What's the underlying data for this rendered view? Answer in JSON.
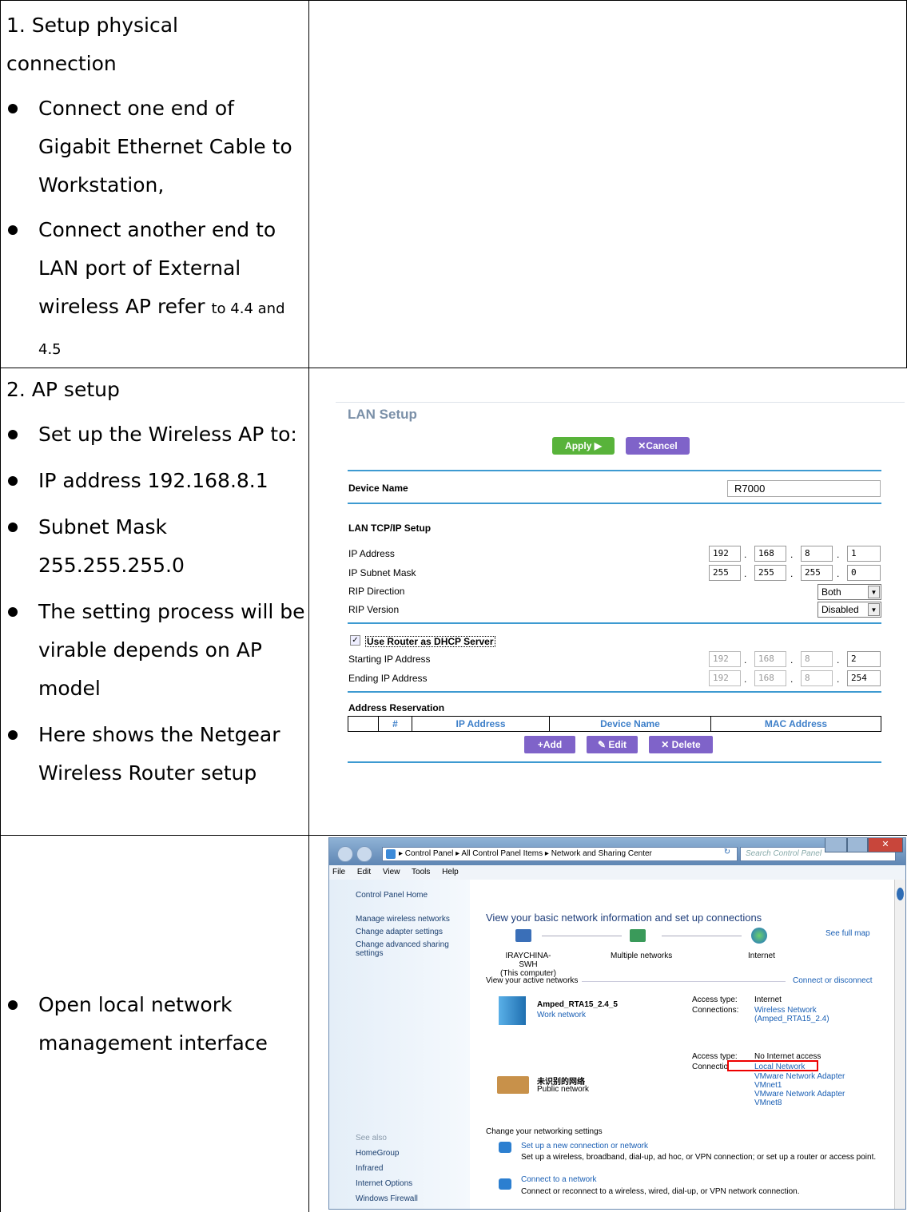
{
  "rows": [
    {
      "heading": "1. Setup physical connection",
      "bullets": [
        {
          "text": "Connect one end of Gigabit Ethernet Cable to Workstation,"
        },
        {
          "text": "Connect another end to LAN port of External wireless AP refer",
          "small": "to 4.4 and 4.5"
        }
      ]
    },
    {
      "heading": "2. AP setup",
      "bullets": [
        {
          "text": "Set up the Wireless AP to:"
        },
        {
          "text": "IP address 192.168.8.1"
        },
        {
          "text": "Subnet Mask 255.255.255.0"
        },
        {
          "text": "The setting process will be  virable depends on AP model"
        },
        {
          "text": "Here shows the Netgear Wireless Router setup"
        }
      ]
    },
    {
      "bullets": [
        {
          "text": "Open local network management interface"
        }
      ]
    }
  ],
  "lan_setup": {
    "title": "LAN Setup",
    "apply_label": "Apply ▶",
    "cancel_label": "✕Cancel",
    "device_name_label": "Device Name",
    "device_name_value": "R7000",
    "tcpip_title": "LAN TCP/IP Setup",
    "ip_address_label": "IP Address",
    "ip_address": [
      "192",
      "168",
      "8",
      "1"
    ],
    "subnet_label": "IP Subnet Mask",
    "subnet": [
      "255",
      "255",
      "255",
      "0"
    ],
    "rip_direction_label": "RIP Direction",
    "rip_direction_value": "Both",
    "rip_version_label": "RIP Version",
    "rip_version_value": "Disabled",
    "dhcp_label": "Use Router as DHCP Server",
    "dhcp_checked": true,
    "start_ip_label": "Starting IP Address",
    "start_ip": [
      "192",
      "168",
      "8",
      "2"
    ],
    "end_ip_label": "Ending IP Address",
    "end_ip": [
      "192",
      "168",
      "8",
      "254"
    ],
    "reservation_title": "Address Reservation",
    "reservation_columns": [
      "",
      "#",
      "IP Address",
      "Device Name",
      "MAC Address"
    ],
    "add_label": "+Add",
    "edit_label": "Edit",
    "delete_label": "✕ Delete",
    "colors": {
      "apply": "#58b33a",
      "purple": "#7f63c9",
      "rule": "#3d9ad1",
      "title": "#7b90a8"
    }
  },
  "windows": {
    "breadcrumb": "▸ Control Panel ▸ All Control Panel Items ▸ Network and Sharing Center",
    "search_placeholder": "Search Control Panel",
    "menu": [
      "File",
      "Edit",
      "View",
      "Tools",
      "Help"
    ],
    "left_links": [
      "Control Panel Home",
      "Manage wireless networks",
      "Change adapter settings",
      "Change advanced sharing settings"
    ],
    "see_also_title": "See also",
    "see_also": [
      "HomeGroup",
      "Infrared",
      "Internet Options",
      "Windows Firewall"
    ],
    "heading": "View your basic network information and set up connections",
    "see_full_map": "See full map",
    "computer_name": "IRAYCHINA-SWH",
    "computer_sub": "(This computer)",
    "multiple_networks": "Multiple networks",
    "internet": "Internet",
    "active_networks": "View your active networks",
    "connect_disconnect": "Connect or disconnect",
    "net1_name": "Amped_RTA15_2.4_5",
    "net1_type": "Work network",
    "access_type_label": "Access type:",
    "net1_access": "Internet",
    "connections_label": "Connections:",
    "net1_conn1": "Wireless Network",
    "net1_conn2": "(Amped_RTA15_2.4)",
    "net2_name": "未识别的网络",
    "net2_type": "Public network",
    "net2_access": "No Internet access",
    "net2_conn_label": "Connectio",
    "net2_conn1": "Local Network",
    "net2_conn2": "VMware Network Adapter",
    "net2_conn3": "VMnet1",
    "net2_conn4": "VMware Network Adapter",
    "net2_conn5": "VMnet8",
    "change_settings": "Change your networking settings",
    "task1": "Set up a new connection or network",
    "task1_desc": "Set up a wireless, broadband, dial-up, ad hoc, or VPN connection; or set up a router or access point.",
    "task2": "Connect to a network",
    "task2_desc": "Connect or reconnect to a wireless, wired, dial-up, or VPN network connection."
  }
}
